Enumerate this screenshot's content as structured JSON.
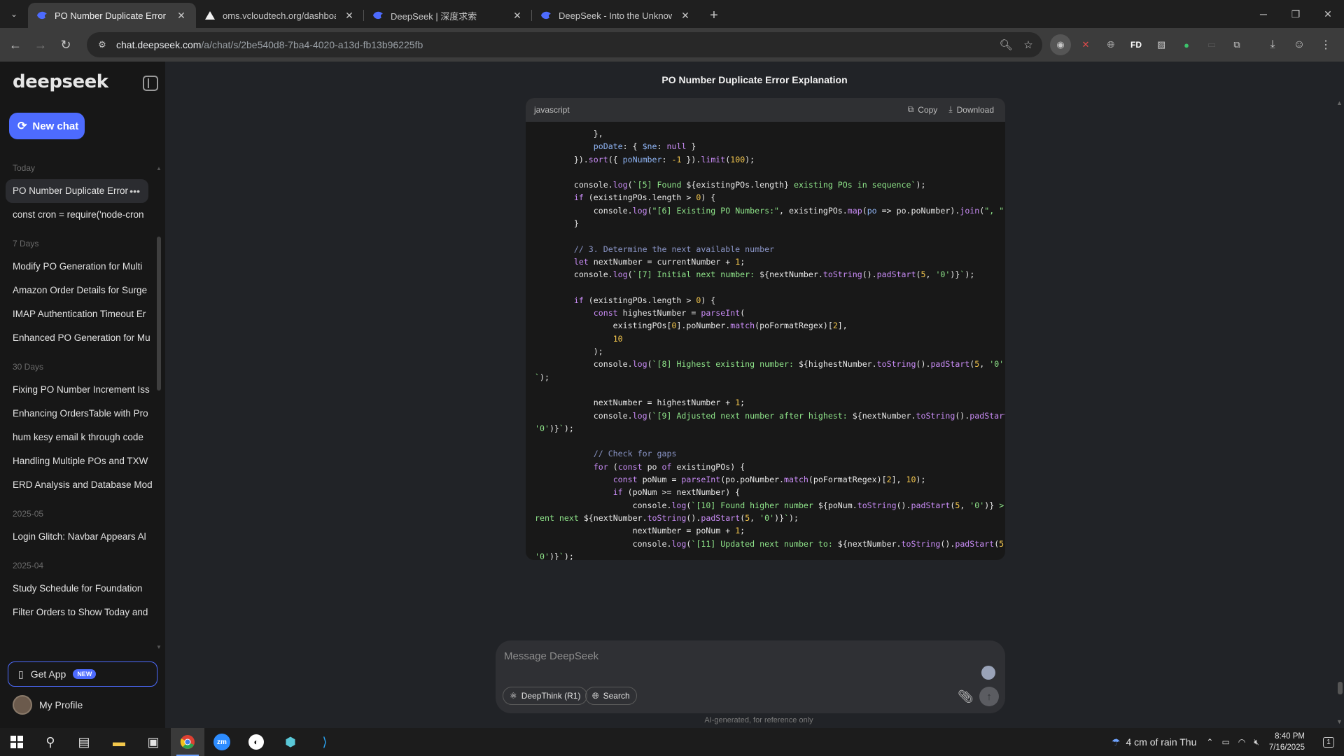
{
  "browser": {
    "tabs": [
      {
        "title": "PO Number Duplicate Error Exp",
        "active": true
      },
      {
        "title": "oms.vcloudtech.org/dashboard",
        "active": false
      },
      {
        "title": "DeepSeek | 深度求索",
        "active": false
      },
      {
        "title": "DeepSeek - Into the Unknown",
        "active": false
      }
    ],
    "url_host": "chat.deepseek.com",
    "url_path": "/a/chat/s/2be540d8-7ba4-4020-a13d-fb13b96225fb"
  },
  "sidebar": {
    "logo": "deepseek",
    "new_chat_label": "New chat",
    "groups": [
      {
        "title": "Today",
        "items": [
          "PO Number Duplicate Error",
          "const cron = require('node-cron"
        ]
      },
      {
        "title": "7 Days",
        "items": [
          "Modify PO Generation for Multi",
          "Amazon Order Details for Surge",
          "IMAP Authentication Timeout Er",
          "Enhanced PO Generation for Mu"
        ]
      },
      {
        "title": "30 Days",
        "items": [
          "Fixing PO Number Increment Iss",
          "Enhancing OrdersTable with Pro",
          "hum kesy email k through code",
          "Handling Multiple POs and TXW",
          "ERD Analysis and Database Mod"
        ]
      },
      {
        "title": "2025-05",
        "items": [
          "Login Glitch: Navbar Appears Al"
        ]
      },
      {
        "title": "2025-04",
        "items": [
          "Study Schedule for Foundation",
          "Filter Orders to Show Today and"
        ]
      }
    ],
    "get_app_label": "Get App",
    "new_badge": "NEW",
    "profile_label": "My Profile"
  },
  "main": {
    "chat_title": "PO Number Duplicate Error Explanation",
    "code_lang": "javascript",
    "copy_label": "Copy",
    "download_label": "Download",
    "composer_placeholder": "Message DeepSeek",
    "deepthink_label": "DeepThink (R1)",
    "search_label": "Search",
    "ai_note": "AI-generated, for reference only"
  },
  "taskbar": {
    "weather": "4 cm of rain Thu",
    "time": "8:40 PM",
    "date": "7/16/2025",
    "notif_count": "1"
  },
  "colors": {
    "accent": "#4d6bfe",
    "sidebar_bg": "#171717",
    "main_bg": "#212327",
    "code_bg": "#181818"
  }
}
